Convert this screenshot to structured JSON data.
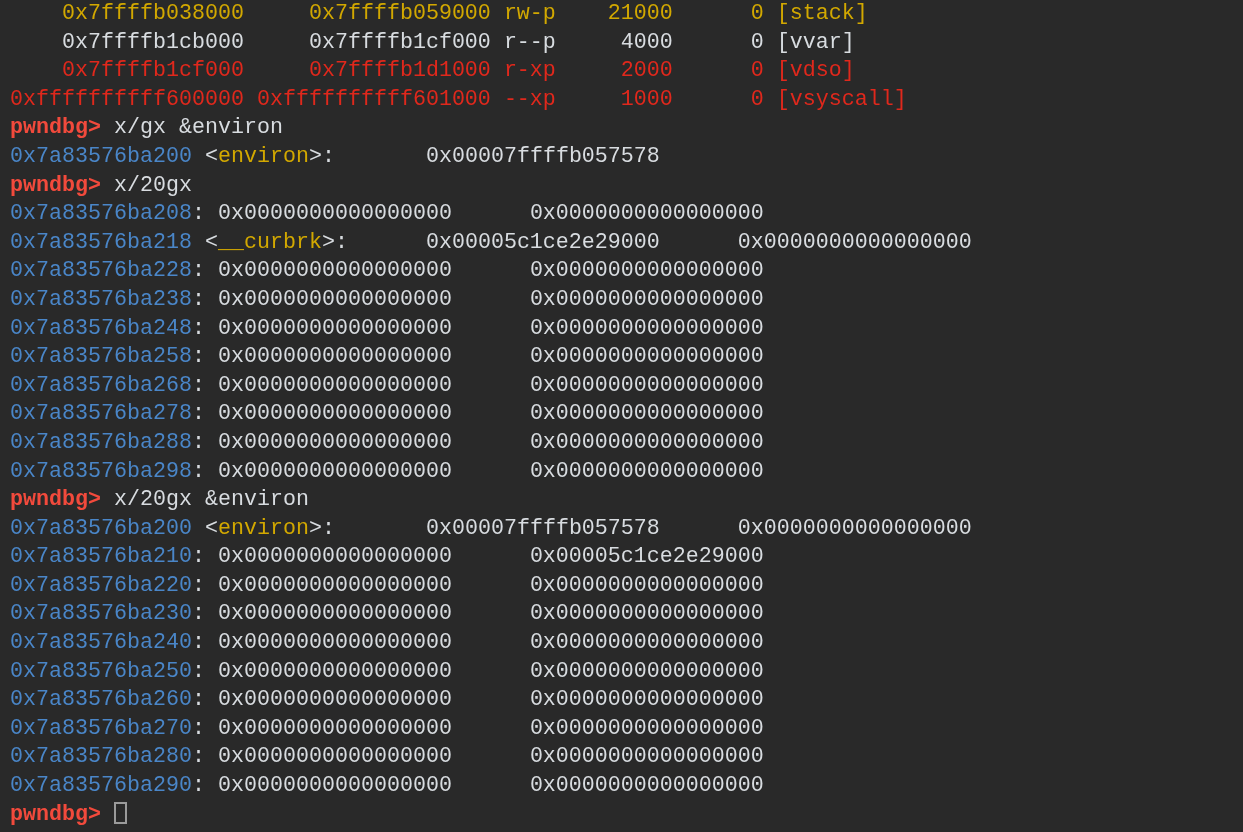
{
  "terminal": {
    "lines": [
      {
        "segments": [
          {
            "kind": "start",
            "text": "    0x7ffffb038000",
            "color": "#d2a800"
          },
          {
            "kind": "end",
            "text": "     0x7ffffb059000",
            "color": "#d2a800"
          },
          {
            "kind": "perms",
            "text": " rw-p",
            "color": "#d2a800"
          },
          {
            "kind": "size",
            "text": "    21000",
            "color": "#d2a800"
          },
          {
            "kind": "offset",
            "text": "      0",
            "color": "#d2a800"
          },
          {
            "kind": "mapname",
            "text": " [stack]",
            "color": "#d2a800"
          }
        ]
      },
      {
        "segments": [
          {
            "kind": "start",
            "text": "    0x7ffffb1cb000",
            "color": "#d8dce0"
          },
          {
            "kind": "end",
            "text": "     0x7ffffb1cf000",
            "color": "#d8dce0"
          },
          {
            "kind": "perms",
            "text": " r--p",
            "color": "#d8dce0"
          },
          {
            "kind": "size",
            "text": "     4000",
            "color": "#d8dce0"
          },
          {
            "kind": "offset",
            "text": "      0",
            "color": "#d8dce0"
          },
          {
            "kind": "mapname",
            "text": " [vvar]",
            "color": "#d8dce0"
          }
        ]
      },
      {
        "segments": [
          {
            "kind": "start",
            "text": "    0x7ffffb1cf000",
            "color": "#e0281c"
          },
          {
            "kind": "end",
            "text": "     0x7ffffb1d1000",
            "color": "#e0281c"
          },
          {
            "kind": "perms",
            "text": " r-xp",
            "color": "#e0281c"
          },
          {
            "kind": "size",
            "text": "     2000",
            "color": "#e0281c"
          },
          {
            "kind": "offset",
            "text": "      0",
            "color": "#e0281c"
          },
          {
            "kind": "mapname",
            "text": " [vdso]",
            "color": "#e0281c"
          }
        ]
      },
      {
        "segments": [
          {
            "kind": "start",
            "text": "0xffffffffff600000",
            "color": "#e0281c"
          },
          {
            "kind": "end",
            "text": " 0xffffffffff601000",
            "color": "#e0281c"
          },
          {
            "kind": "perms",
            "text": " --xp",
            "color": "#e0281c"
          },
          {
            "kind": "size",
            "text": "     1000",
            "color": "#e0281c"
          },
          {
            "kind": "offset",
            "text": "      0",
            "color": "#e0281c"
          },
          {
            "kind": "mapname",
            "text": " [vsyscall]",
            "color": "#e0281c"
          }
        ]
      },
      {
        "segments": [
          {
            "kind": "prompt",
            "text": "pwndbg>",
            "color": "#f24a3c"
          },
          {
            "kind": "command",
            "text": " x/gx &environ",
            "color": "#d8dce0"
          }
        ]
      },
      {
        "segments": [
          {
            "kind": "address",
            "text": "0x7a83576ba200",
            "color": "#4a86c8"
          },
          {
            "kind": "punct",
            "text": " <",
            "color": "#d8dce0"
          },
          {
            "kind": "symbol",
            "text": "environ",
            "color": "#d2a800"
          },
          {
            "kind": "punct",
            "text": ">:",
            "color": "#d8dce0"
          },
          {
            "kind": "value",
            "text": "       0x00007ffffb057578",
            "color": "#d8dce0"
          }
        ]
      },
      {
        "segments": [
          {
            "kind": "prompt",
            "text": "pwndbg>",
            "color": "#f24a3c"
          },
          {
            "kind": "command",
            "text": " x/20gx",
            "color": "#d8dce0"
          }
        ]
      },
      {
        "segments": [
          {
            "kind": "address",
            "text": "0x7a83576ba208",
            "color": "#4a86c8"
          },
          {
            "kind": "punct",
            "text": ":",
            "color": "#d8dce0"
          },
          {
            "kind": "value",
            "text": " 0x0000000000000000",
            "color": "#d8dce0"
          },
          {
            "kind": "value",
            "text": "      0x0000000000000000",
            "color": "#d8dce0"
          }
        ]
      },
      {
        "segments": [
          {
            "kind": "address",
            "text": "0x7a83576ba218",
            "color": "#4a86c8"
          },
          {
            "kind": "punct",
            "text": " <",
            "color": "#d8dce0"
          },
          {
            "kind": "symbol",
            "text": "__curbrk",
            "color": "#d2a800"
          },
          {
            "kind": "punct",
            "text": ">:",
            "color": "#d8dce0"
          },
          {
            "kind": "value",
            "text": "      0x00005c1ce2e29000",
            "color": "#d8dce0"
          },
          {
            "kind": "value",
            "text": "      0x0000000000000000",
            "color": "#d8dce0"
          }
        ]
      },
      {
        "segments": [
          {
            "kind": "address",
            "text": "0x7a83576ba228",
            "color": "#4a86c8"
          },
          {
            "kind": "punct",
            "text": ":",
            "color": "#d8dce0"
          },
          {
            "kind": "value",
            "text": " 0x0000000000000000",
            "color": "#d8dce0"
          },
          {
            "kind": "value",
            "text": "      0x0000000000000000",
            "color": "#d8dce0"
          }
        ]
      },
      {
        "segments": [
          {
            "kind": "address",
            "text": "0x7a83576ba238",
            "color": "#4a86c8"
          },
          {
            "kind": "punct",
            "text": ":",
            "color": "#d8dce0"
          },
          {
            "kind": "value",
            "text": " 0x0000000000000000",
            "color": "#d8dce0"
          },
          {
            "kind": "value",
            "text": "      0x0000000000000000",
            "color": "#d8dce0"
          }
        ]
      },
      {
        "segments": [
          {
            "kind": "address",
            "text": "0x7a83576ba248",
            "color": "#4a86c8"
          },
          {
            "kind": "punct",
            "text": ":",
            "color": "#d8dce0"
          },
          {
            "kind": "value",
            "text": " 0x0000000000000000",
            "color": "#d8dce0"
          },
          {
            "kind": "value",
            "text": "      0x0000000000000000",
            "color": "#d8dce0"
          }
        ]
      },
      {
        "segments": [
          {
            "kind": "address",
            "text": "0x7a83576ba258",
            "color": "#4a86c8"
          },
          {
            "kind": "punct",
            "text": ":",
            "color": "#d8dce0"
          },
          {
            "kind": "value",
            "text": " 0x0000000000000000",
            "color": "#d8dce0"
          },
          {
            "kind": "value",
            "text": "      0x0000000000000000",
            "color": "#d8dce0"
          }
        ]
      },
      {
        "segments": [
          {
            "kind": "address",
            "text": "0x7a83576ba268",
            "color": "#4a86c8"
          },
          {
            "kind": "punct",
            "text": ":",
            "color": "#d8dce0"
          },
          {
            "kind": "value",
            "text": " 0x0000000000000000",
            "color": "#d8dce0"
          },
          {
            "kind": "value",
            "text": "      0x0000000000000000",
            "color": "#d8dce0"
          }
        ]
      },
      {
        "segments": [
          {
            "kind": "address",
            "text": "0x7a83576ba278",
            "color": "#4a86c8"
          },
          {
            "kind": "punct",
            "text": ":",
            "color": "#d8dce0"
          },
          {
            "kind": "value",
            "text": " 0x0000000000000000",
            "color": "#d8dce0"
          },
          {
            "kind": "value",
            "text": "      0x0000000000000000",
            "color": "#d8dce0"
          }
        ]
      },
      {
        "segments": [
          {
            "kind": "address",
            "text": "0x7a83576ba288",
            "color": "#4a86c8"
          },
          {
            "kind": "punct",
            "text": ":",
            "color": "#d8dce0"
          },
          {
            "kind": "value",
            "text": " 0x0000000000000000",
            "color": "#d8dce0"
          },
          {
            "kind": "value",
            "text": "      0x0000000000000000",
            "color": "#d8dce0"
          }
        ]
      },
      {
        "segments": [
          {
            "kind": "address",
            "text": "0x7a83576ba298",
            "color": "#4a86c8"
          },
          {
            "kind": "punct",
            "text": ":",
            "color": "#d8dce0"
          },
          {
            "kind": "value",
            "text": " 0x0000000000000000",
            "color": "#d8dce0"
          },
          {
            "kind": "value",
            "text": "      0x0000000000000000",
            "color": "#d8dce0"
          }
        ]
      },
      {
        "segments": [
          {
            "kind": "prompt",
            "text": "pwndbg>",
            "color": "#f24a3c"
          },
          {
            "kind": "command",
            "text": " x/20gx &environ",
            "color": "#d8dce0"
          }
        ]
      },
      {
        "segments": [
          {
            "kind": "address",
            "text": "0x7a83576ba200",
            "color": "#4a86c8"
          },
          {
            "kind": "punct",
            "text": " <",
            "color": "#d8dce0"
          },
          {
            "kind": "symbol",
            "text": "environ",
            "color": "#d2a800"
          },
          {
            "kind": "punct",
            "text": ">:",
            "color": "#d8dce0"
          },
          {
            "kind": "value",
            "text": "       0x00007ffffb057578",
            "color": "#d8dce0"
          },
          {
            "kind": "value",
            "text": "      0x0000000000000000",
            "color": "#d8dce0"
          }
        ]
      },
      {
        "segments": [
          {
            "kind": "address",
            "text": "0x7a83576ba210",
            "color": "#4a86c8"
          },
          {
            "kind": "punct",
            "text": ":",
            "color": "#d8dce0"
          },
          {
            "kind": "value",
            "text": " 0x0000000000000000",
            "color": "#d8dce0"
          },
          {
            "kind": "value",
            "text": "      0x00005c1ce2e29000",
            "color": "#d8dce0"
          }
        ]
      },
      {
        "segments": [
          {
            "kind": "address",
            "text": "0x7a83576ba220",
            "color": "#4a86c8"
          },
          {
            "kind": "punct",
            "text": ":",
            "color": "#d8dce0"
          },
          {
            "kind": "value",
            "text": " 0x0000000000000000",
            "color": "#d8dce0"
          },
          {
            "kind": "value",
            "text": "      0x0000000000000000",
            "color": "#d8dce0"
          }
        ]
      },
      {
        "segments": [
          {
            "kind": "address",
            "text": "0x7a83576ba230",
            "color": "#4a86c8"
          },
          {
            "kind": "punct",
            "text": ":",
            "color": "#d8dce0"
          },
          {
            "kind": "value",
            "text": " 0x0000000000000000",
            "color": "#d8dce0"
          },
          {
            "kind": "value",
            "text": "      0x0000000000000000",
            "color": "#d8dce0"
          }
        ]
      },
      {
        "segments": [
          {
            "kind": "address",
            "text": "0x7a83576ba240",
            "color": "#4a86c8"
          },
          {
            "kind": "punct",
            "text": ":",
            "color": "#d8dce0"
          },
          {
            "kind": "value",
            "text": " 0x0000000000000000",
            "color": "#d8dce0"
          },
          {
            "kind": "value",
            "text": "      0x0000000000000000",
            "color": "#d8dce0"
          }
        ]
      },
      {
        "segments": [
          {
            "kind": "address",
            "text": "0x7a83576ba250",
            "color": "#4a86c8"
          },
          {
            "kind": "punct",
            "text": ":",
            "color": "#d8dce0"
          },
          {
            "kind": "value",
            "text": " 0x0000000000000000",
            "color": "#d8dce0"
          },
          {
            "kind": "value",
            "text": "      0x0000000000000000",
            "color": "#d8dce0"
          }
        ]
      },
      {
        "segments": [
          {
            "kind": "address",
            "text": "0x7a83576ba260",
            "color": "#4a86c8"
          },
          {
            "kind": "punct",
            "text": ":",
            "color": "#d8dce0"
          },
          {
            "kind": "value",
            "text": " 0x0000000000000000",
            "color": "#d8dce0"
          },
          {
            "kind": "value",
            "text": "      0x0000000000000000",
            "color": "#d8dce0"
          }
        ]
      },
      {
        "segments": [
          {
            "kind": "address",
            "text": "0x7a83576ba270",
            "color": "#4a86c8"
          },
          {
            "kind": "punct",
            "text": ":",
            "color": "#d8dce0"
          },
          {
            "kind": "value",
            "text": " 0x0000000000000000",
            "color": "#d8dce0"
          },
          {
            "kind": "value",
            "text": "      0x0000000000000000",
            "color": "#d8dce0"
          }
        ]
      },
      {
        "segments": [
          {
            "kind": "address",
            "text": "0x7a83576ba280",
            "color": "#4a86c8"
          },
          {
            "kind": "punct",
            "text": ":",
            "color": "#d8dce0"
          },
          {
            "kind": "value",
            "text": " 0x0000000000000000",
            "color": "#d8dce0"
          },
          {
            "kind": "value",
            "text": "      0x0000000000000000",
            "color": "#d8dce0"
          }
        ]
      },
      {
        "segments": [
          {
            "kind": "address",
            "text": "0x7a83576ba290",
            "color": "#4a86c8"
          },
          {
            "kind": "punct",
            "text": ":",
            "color": "#d8dce0"
          },
          {
            "kind": "value",
            "text": " 0x0000000000000000",
            "color": "#d8dce0"
          },
          {
            "kind": "value",
            "text": "      0x0000000000000000",
            "color": "#d8dce0"
          }
        ]
      },
      {
        "segments": [
          {
            "kind": "prompt",
            "text": "pwndbg>",
            "color": "#f24a3c"
          }
        ],
        "cursor": true
      }
    ]
  }
}
